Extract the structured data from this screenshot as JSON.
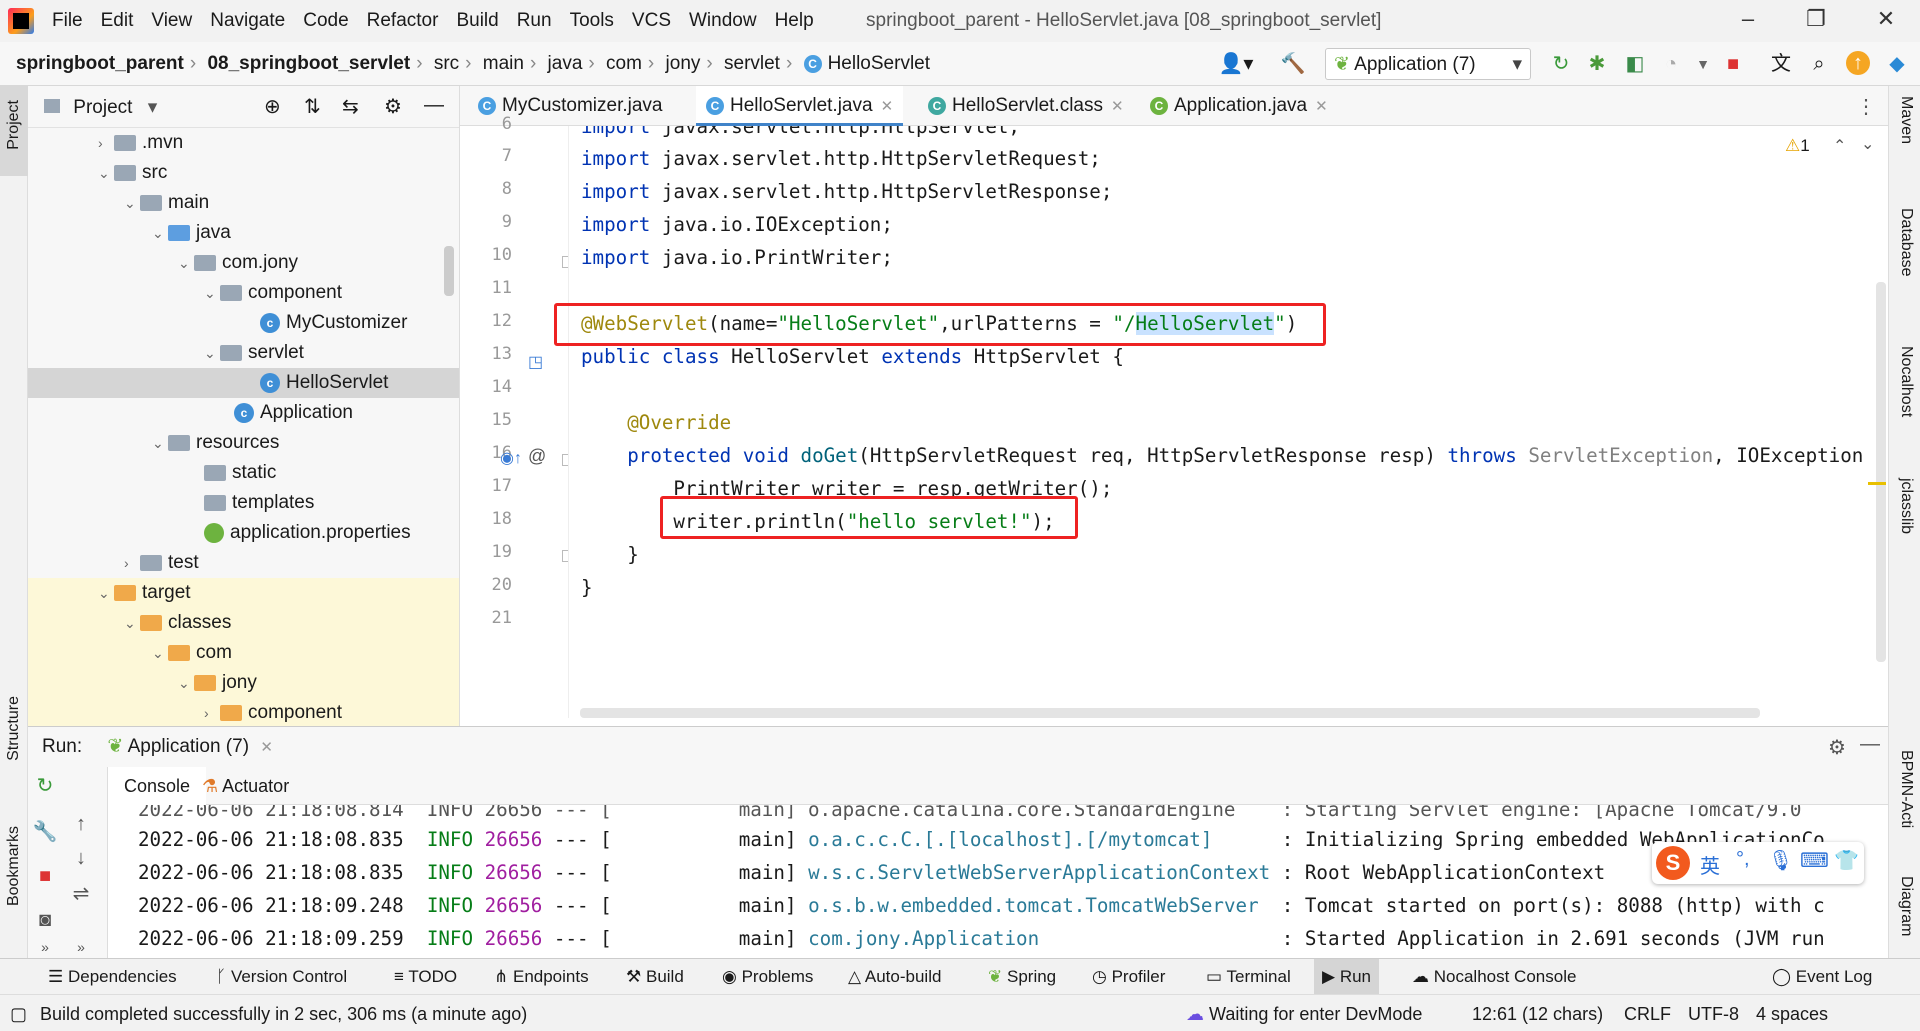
{
  "menubar": {
    "items": [
      "File",
      "Edit",
      "View",
      "Navigate",
      "Code",
      "Refactor",
      "Build",
      "Run",
      "Tools",
      "VCS",
      "Window",
      "Help"
    ],
    "title": "springboot_parent - HelloServlet.java [08_springboot_servlet]"
  },
  "breadcrumb": [
    "springboot_parent",
    "08_springboot_servlet",
    "src",
    "main",
    "java",
    "com",
    "jony",
    "servlet",
    "HelloServlet"
  ],
  "toolbar": {
    "run_config": "Application (7)"
  },
  "sidestrip": {
    "project": "Project",
    "structure": "Structure",
    "bookmarks": "Bookmarks",
    "maven": "Maven",
    "database": "Database",
    "nocalhost": "Nocalhost",
    "jclasslib": "jclasslib",
    "bpmn": "BPMN-Acti",
    "diagram": "Diagram"
  },
  "project": {
    "title": "Project",
    "tree": [
      {
        "label": ".mvn",
        "type": "folder"
      },
      {
        "label": "src",
        "type": "folder"
      },
      {
        "label": "main",
        "type": "folder"
      },
      {
        "label": "java",
        "type": "folder-blue"
      },
      {
        "label": "com.jony",
        "type": "folder"
      },
      {
        "label": "component",
        "type": "folder"
      },
      {
        "label": "MyCustomizer",
        "type": "class"
      },
      {
        "label": "servlet",
        "type": "folder"
      },
      {
        "label": "HelloServlet",
        "type": "class"
      },
      {
        "label": "Application",
        "type": "class"
      },
      {
        "label": "resources",
        "type": "folder"
      },
      {
        "label": "static",
        "type": "folder"
      },
      {
        "label": "templates",
        "type": "folder"
      },
      {
        "label": "application.properties",
        "type": "leaf"
      },
      {
        "label": "test",
        "type": "folder"
      },
      {
        "label": "target",
        "type": "folder-orange"
      },
      {
        "label": "classes",
        "type": "folder-orange"
      },
      {
        "label": "com",
        "type": "folder-orange"
      },
      {
        "label": "jony",
        "type": "folder-orange"
      },
      {
        "label": "component",
        "type": "folder-orange"
      }
    ]
  },
  "tabs": [
    {
      "label": "MyCustomizer.java"
    },
    {
      "label": "HelloServlet.java"
    },
    {
      "label": "HelloServlet.class"
    },
    {
      "label": "Application.java"
    }
  ],
  "editor": {
    "warning_count": "1",
    "line_numbers": [
      "6",
      "7",
      "8",
      "9",
      "10",
      "11",
      "12",
      "13",
      "14",
      "15",
      "16",
      "17",
      "18",
      "19",
      "20",
      "21"
    ]
  },
  "run": {
    "label": "Run:",
    "config": "Application (7)",
    "tabs": [
      "Console",
      "Actuator"
    ],
    "log": [
      {
        "ts": "2022-06-06 21:18:08.835",
        "level": "INFO",
        "pid": "26656",
        "sep": "--- [",
        "thread": "main]",
        "logger": "o.a.c.c.C.[.[localhost].[/mytomcat]",
        "msg": ": Initializing Spring embedded WebApplicationCo"
      },
      {
        "ts": "2022-06-06 21:18:08.835",
        "level": "INFO",
        "pid": "26656",
        "sep": "--- [",
        "thread": "main]",
        "logger": "w.s.c.ServletWebServerApplicationContext",
        "msg": ": Root WebApplicationContext"
      },
      {
        "ts": "2022-06-06 21:18:09.248",
        "level": "INFO",
        "pid": "26656",
        "sep": "--- [",
        "thread": "main]",
        "logger": "o.s.b.w.embedded.tomcat.TomcatWebServer",
        "msg": ": Tomcat started on port(s): 8088 (http) with c"
      },
      {
        "ts": "2022-06-06 21:18:09.259",
        "level": "INFO",
        "pid": "26656",
        "sep": "--- [",
        "thread": "main]",
        "logger": "com.jony.Application",
        "msg": ": Started Application in 2.691 seconds (JVM run"
      }
    ]
  },
  "bottomtools": [
    "Dependencies",
    "Version Control",
    "TODO",
    "Endpoints",
    "Build",
    "Problems",
    "Auto-build",
    "Spring",
    "Profiler",
    "Terminal",
    "Run",
    "Nocalhost Console",
    "Event Log"
  ],
  "status": {
    "message": "Build completed successfully in 2 sec, 306 ms (a minute ago)",
    "devmode": "Waiting for enter DevMode",
    "position": "12:61 (12 chars)",
    "eol": "CRLF",
    "encoding": "UTF-8",
    "indent": "4 spaces"
  },
  "ime": {
    "lang": "英"
  }
}
